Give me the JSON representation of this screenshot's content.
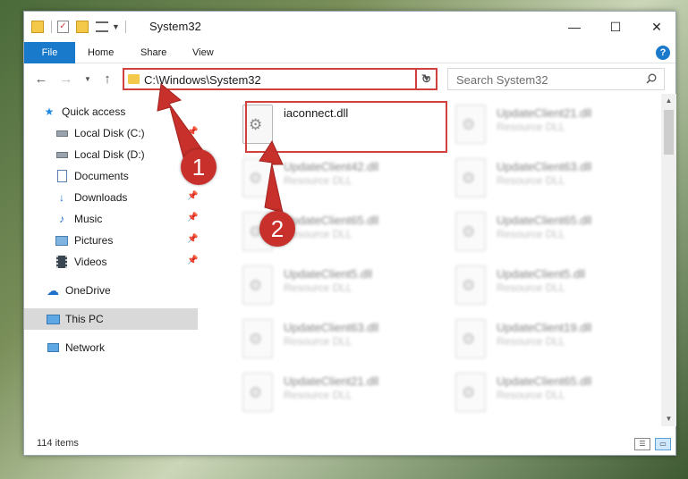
{
  "window": {
    "title": "System32",
    "controls": {
      "minimize": "—",
      "maximize": "☐",
      "close": "✕"
    }
  },
  "ribbon": {
    "tabs": [
      "File",
      "Home",
      "Share",
      "View"
    ],
    "help": "?"
  },
  "nav": {
    "address": "C:\\Windows\\System32",
    "search_placeholder": "Search System32"
  },
  "sidebar": {
    "items": [
      {
        "label": "Quick access",
        "icon": "star-icon",
        "pinned": false
      },
      {
        "label": "Local Disk (C:)",
        "icon": "drive-icon",
        "pinned": true
      },
      {
        "label": "Local Disk (D:)",
        "icon": "drive-icon",
        "pinned": false
      },
      {
        "label": "Documents",
        "icon": "documents-icon",
        "pinned": true
      },
      {
        "label": "Downloads",
        "icon": "download-icon",
        "pinned": true
      },
      {
        "label": "Music",
        "icon": "music-icon",
        "pinned": true
      },
      {
        "label": "Pictures",
        "icon": "pictures-icon",
        "pinned": true
      },
      {
        "label": "Videos",
        "icon": "videos-icon",
        "pinned": true
      },
      {
        "label": "OneDrive",
        "icon": "cloud-icon",
        "pinned": false
      },
      {
        "label": "This PC",
        "icon": "computer-icon",
        "pinned": false,
        "selected": true
      },
      {
        "label": "Network",
        "icon": "network-icon",
        "pinned": false
      }
    ]
  },
  "files": [
    {
      "name": "iaconnect.dll",
      "type": "",
      "highlighted": true
    },
    {
      "name": "UpdateClient21.dll",
      "type": "Resource DLL"
    },
    {
      "name": "UpdateClient42.dll",
      "type": "Resource DLL"
    },
    {
      "name": "UpdateClient63.dll",
      "type": "Resource DLL"
    },
    {
      "name": "UpdateClient65.dll",
      "type": "Resource DLL"
    },
    {
      "name": "UpdateClient65.dll",
      "type": "Resource DLL"
    },
    {
      "name": "UpdateClient5.dll",
      "type": "Resource DLL"
    },
    {
      "name": "UpdateClient5.dll",
      "type": "Resource DLL"
    },
    {
      "name": "UpdateClient63.dll",
      "type": "Resource DLL"
    },
    {
      "name": "UpdateClient19.dll",
      "type": "Resource DLL"
    },
    {
      "name": "UpdateClient21.dll",
      "type": "Resource DLL"
    },
    {
      "name": "UpdateClient65.dll",
      "type": "Resource DLL"
    }
  ],
  "status": {
    "item_count": "114 items"
  },
  "annotations": {
    "step1": "1",
    "step2": "2",
    "color": "#c8302c"
  }
}
